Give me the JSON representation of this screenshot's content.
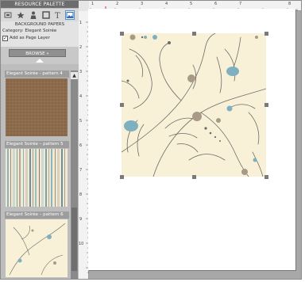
{
  "palette": {
    "title": "RESOURCE PALETTE",
    "tools": [
      "page-icon",
      "flower-icon",
      "person-icon",
      "frame-icon",
      "text-icon",
      "image-icon"
    ],
    "category_title": "BACKGROUND PAPERS",
    "category": "Category: Elegant Soirée",
    "add_as_page_layer": "Add as Page Layer",
    "add_as_page_layer_checked": true,
    "browse_label": "BROWSE »",
    "items": [
      {
        "label": "Elegant Soirée - pattern 4"
      },
      {
        "label": "Elegant Soirée – pattern 5"
      },
      {
        "label": "Elegant Soirée – pattern 6"
      }
    ]
  },
  "ruler": {
    "top_numbers": [
      "1",
      "2",
      "3",
      "4",
      "5",
      "6",
      "7",
      "8"
    ],
    "left_numbers": [
      "1",
      "2",
      "3",
      "4",
      "5",
      "6",
      "7",
      "8",
      "9",
      "10"
    ]
  },
  "colors": {
    "pattern_bg": "#f8f1d8",
    "ink": "#6b6b66",
    "accent_blue": "#7fb0c0",
    "accent_brown": "#a89a86",
    "thumb4": "#8a6a4a"
  }
}
